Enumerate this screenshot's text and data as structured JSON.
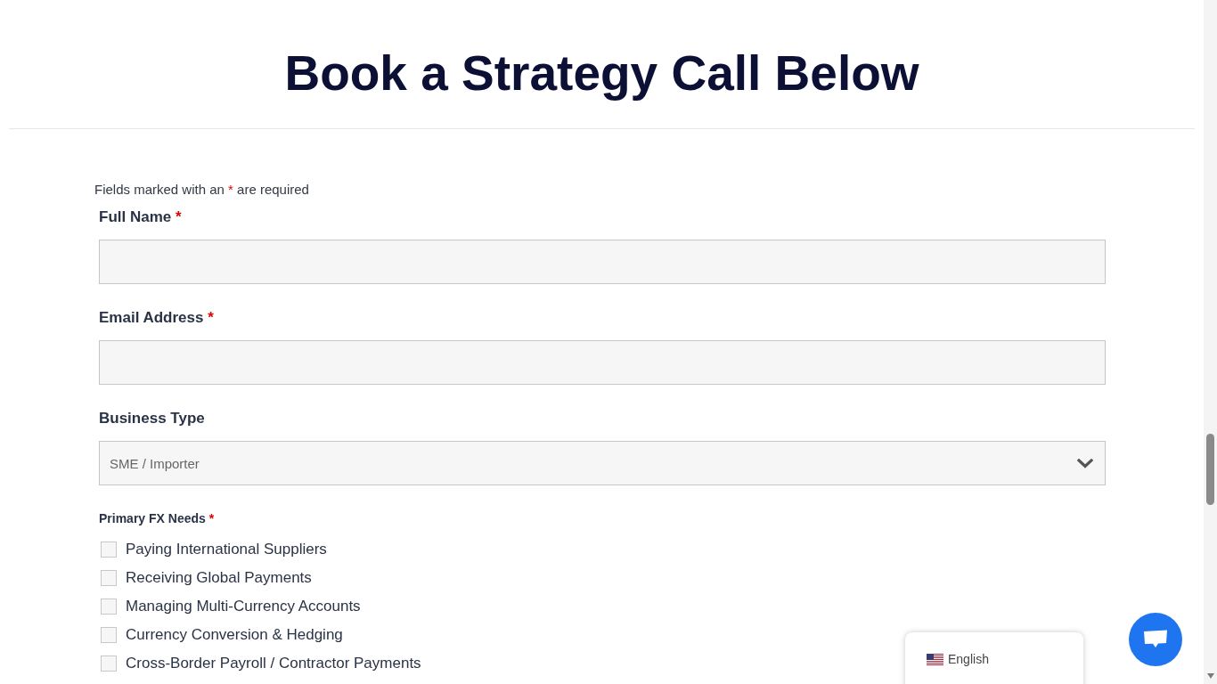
{
  "heading": "Book a Strategy Call Below",
  "form": {
    "required_note": {
      "text_before": "Fields marked with an",
      "mark": "*",
      "text_after": "are required"
    },
    "fields": [
      {
        "kind": "text",
        "label": "Full Name",
        "required_mark": "*"
      },
      {
        "kind": "text",
        "label": "Email Address",
        "required_mark": "*"
      },
      {
        "kind": "select",
        "label": "Business Type",
        "value": "SME / Importer"
      }
    ],
    "checkbox_group": {
      "label": "Primary FX Needs",
      "required_mark": "*",
      "options": [
        {
          "label": "Paying International Suppliers",
          "checked": false
        },
        {
          "label": "Receiving Global Payments",
          "checked": false
        },
        {
          "label": "Managing Multi-Currency Accounts",
          "checked": false
        },
        {
          "label": "Currency Conversion & Hedging",
          "checked": false
        },
        {
          "label": "Cross-Border Payroll / Contractor Payments",
          "checked": false
        }
      ]
    }
  },
  "language_selector": {
    "label": "English"
  }
}
